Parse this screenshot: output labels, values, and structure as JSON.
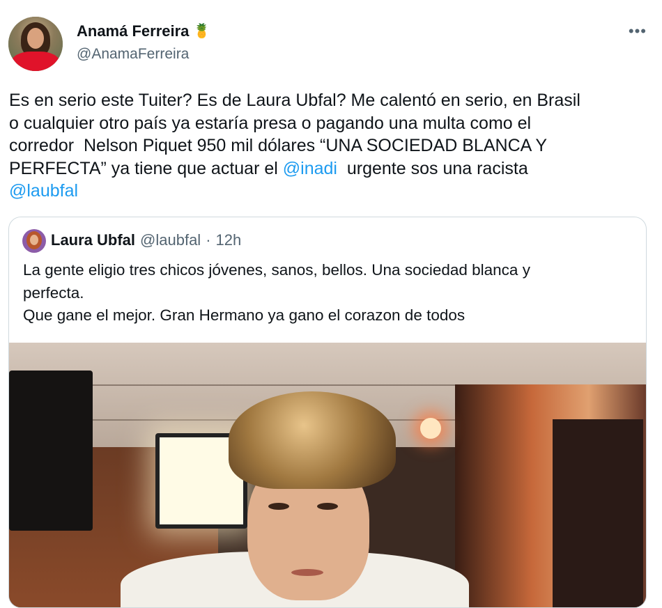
{
  "author": {
    "display_name": "Anamá Ferreira",
    "emoji": "🍍",
    "handle": "@AnamaFerreira"
  },
  "more_menu": "•••",
  "tweet": {
    "text_1": "Es en serio este Tuiter? Es de Laura Ubfal? Me calentó en serio, en Brasil\no cualquier otro país ya estaría presa o pagando una multa como el\ncorredor  Nelson Piquet 950 mil dólares “UNA SOCIEDAD BLANCA Y\nPERFECTA” ya tiene que actuar el ",
    "mention_1": "@inadi",
    "text_2": "  urgente sos una racista\n",
    "mention_2": "@laubfal"
  },
  "quoted": {
    "name": "Laura Ubfal",
    "handle": "@laubfal",
    "separator": "·",
    "time": "12h",
    "text": "La gente eligio tres chicos jóvenes, sanos, bellos. Una sociedad blanca y\nperfecta.\nQue gane el mejor. Gran Hermano ya gano el corazon de todos"
  },
  "colors": {
    "link": "#1d9bf0",
    "secondary_text": "#536471",
    "border": "#cfd9de"
  }
}
